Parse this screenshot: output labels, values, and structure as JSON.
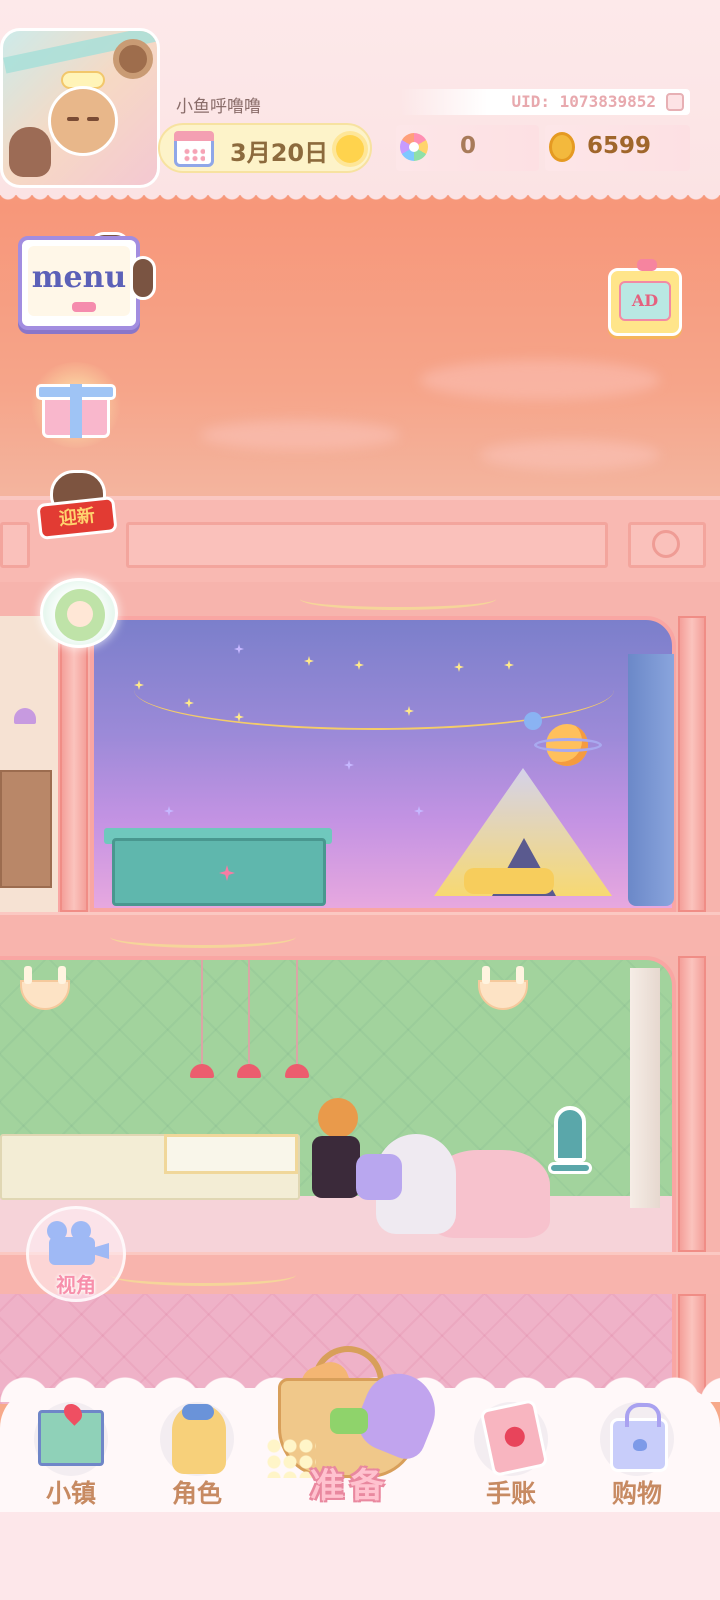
{
  "header": {
    "username": "小鱼呼噜噜",
    "uid": "UID: 1073839852",
    "date": "3月20日",
    "weather_icon": "sun-icon",
    "gems": "0",
    "coins": "6599"
  },
  "side_buttons": {
    "menu_label": "menu",
    "event_banner_label": "迎新",
    "ad_label": "AD"
  },
  "view_button": {
    "label": "视角"
  },
  "bottom_nav": {
    "items": [
      {
        "label": "小镇",
        "icon": "town-map-icon"
      },
      {
        "label": "角色",
        "icon": "character-icon"
      },
      {
        "label": "准备",
        "icon": "basket-icon"
      },
      {
        "label": "手账",
        "icon": "journal-icon"
      },
      {
        "label": "购物",
        "icon": "shopping-bag-icon"
      }
    ]
  },
  "colors": {
    "sky": "#f7977a",
    "building": "#f7b4ad",
    "nav_label": "#c78a62",
    "accent_pink": "#f78fab"
  }
}
